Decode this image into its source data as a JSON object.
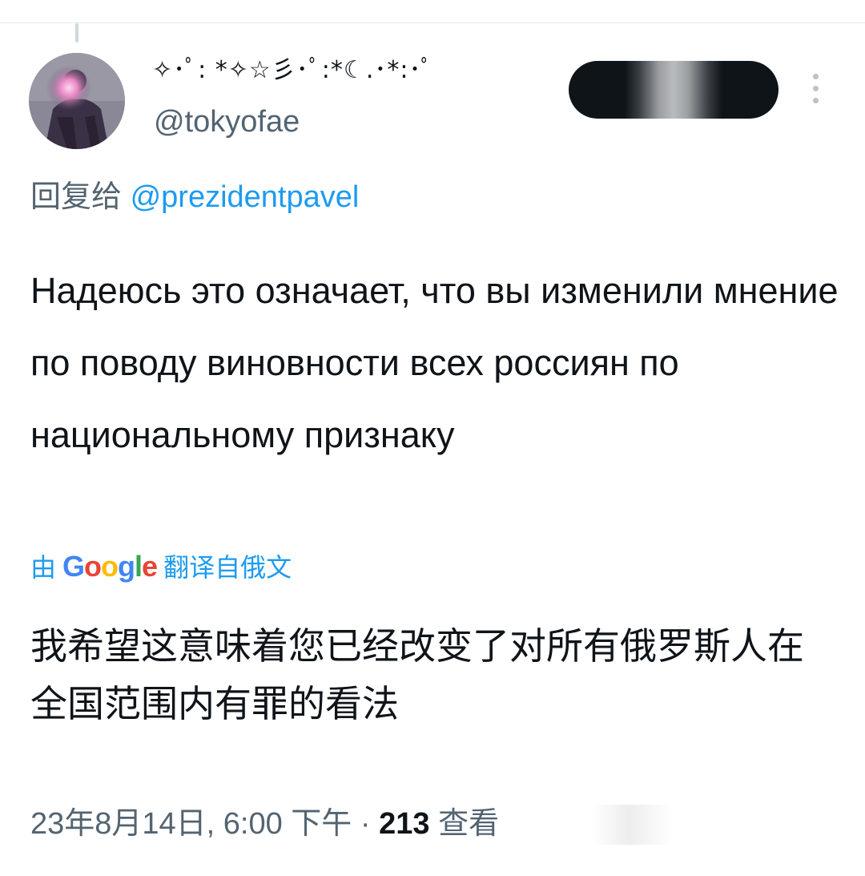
{
  "tweet": {
    "author": {
      "display_name": "✧･ﾟ: *✧☆彡･ﾟ:*☾.･*:･ﾟ",
      "handle": "@tokyofae"
    },
    "follow_button_label": "",
    "reply_prefix": "回复给",
    "reply_mention": "@prezidentpavel",
    "text": "Надеюсь это означает, что вы изменили мнение по поводу виновности всех россиян по национальному признаку",
    "translation": {
      "by_prefix": "由",
      "provider_parts": [
        "G",
        "o",
        "o",
        "g",
        "l",
        "e"
      ],
      "suffix": "翻译自俄文",
      "text": "我希望这意味着您已经改变了对所有俄罗斯人在全国范围内有罪的看法"
    },
    "timestamp": "23年8月14日, 6:00 下午",
    "separator": "·",
    "views_count": "213",
    "views_label": "查看"
  },
  "icons": {
    "more": "more-vertical-icon",
    "avatar": "avatar-image"
  },
  "colors": {
    "link": "#1d9bf0",
    "secondary": "#536471",
    "primary": "#0f1419"
  }
}
